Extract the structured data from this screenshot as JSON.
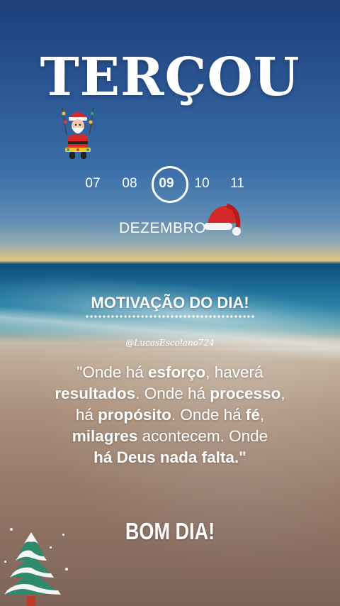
{
  "title": "TERÇOU",
  "dates": {
    "items": [
      "07",
      "08",
      "09",
      "10",
      "11"
    ],
    "current": "09"
  },
  "month": "DEZEMBRO",
  "heading": "MOTIVAÇÃO DO DIA!",
  "handle": "@LucasEscolano724",
  "quote": {
    "l1a": "\"Onde há ",
    "l1b": "esforço",
    "l1c": ", haverá",
    "l2a": "resultados",
    "l2b": ". Onde há ",
    "l2c": "processo",
    "l2d": ",",
    "l3a": "há ",
    "l3b": "propósito",
    "l3c": ". Onde há ",
    "l3d": "fé",
    "l3e": ",",
    "l4a": "milagres",
    "l4b": " acontecem. Onde",
    "l5a": "há Deus nada falta.\""
  },
  "greeting": "BOM DIA!",
  "icons": {
    "santa": "santa-claus-icon",
    "hat": "santa-hat-icon",
    "tree": "christmas-tree-icon"
  },
  "colors": {
    "text": "#ffffff",
    "santa_red": "#d62828",
    "tree_green": "#2d8a6a"
  }
}
